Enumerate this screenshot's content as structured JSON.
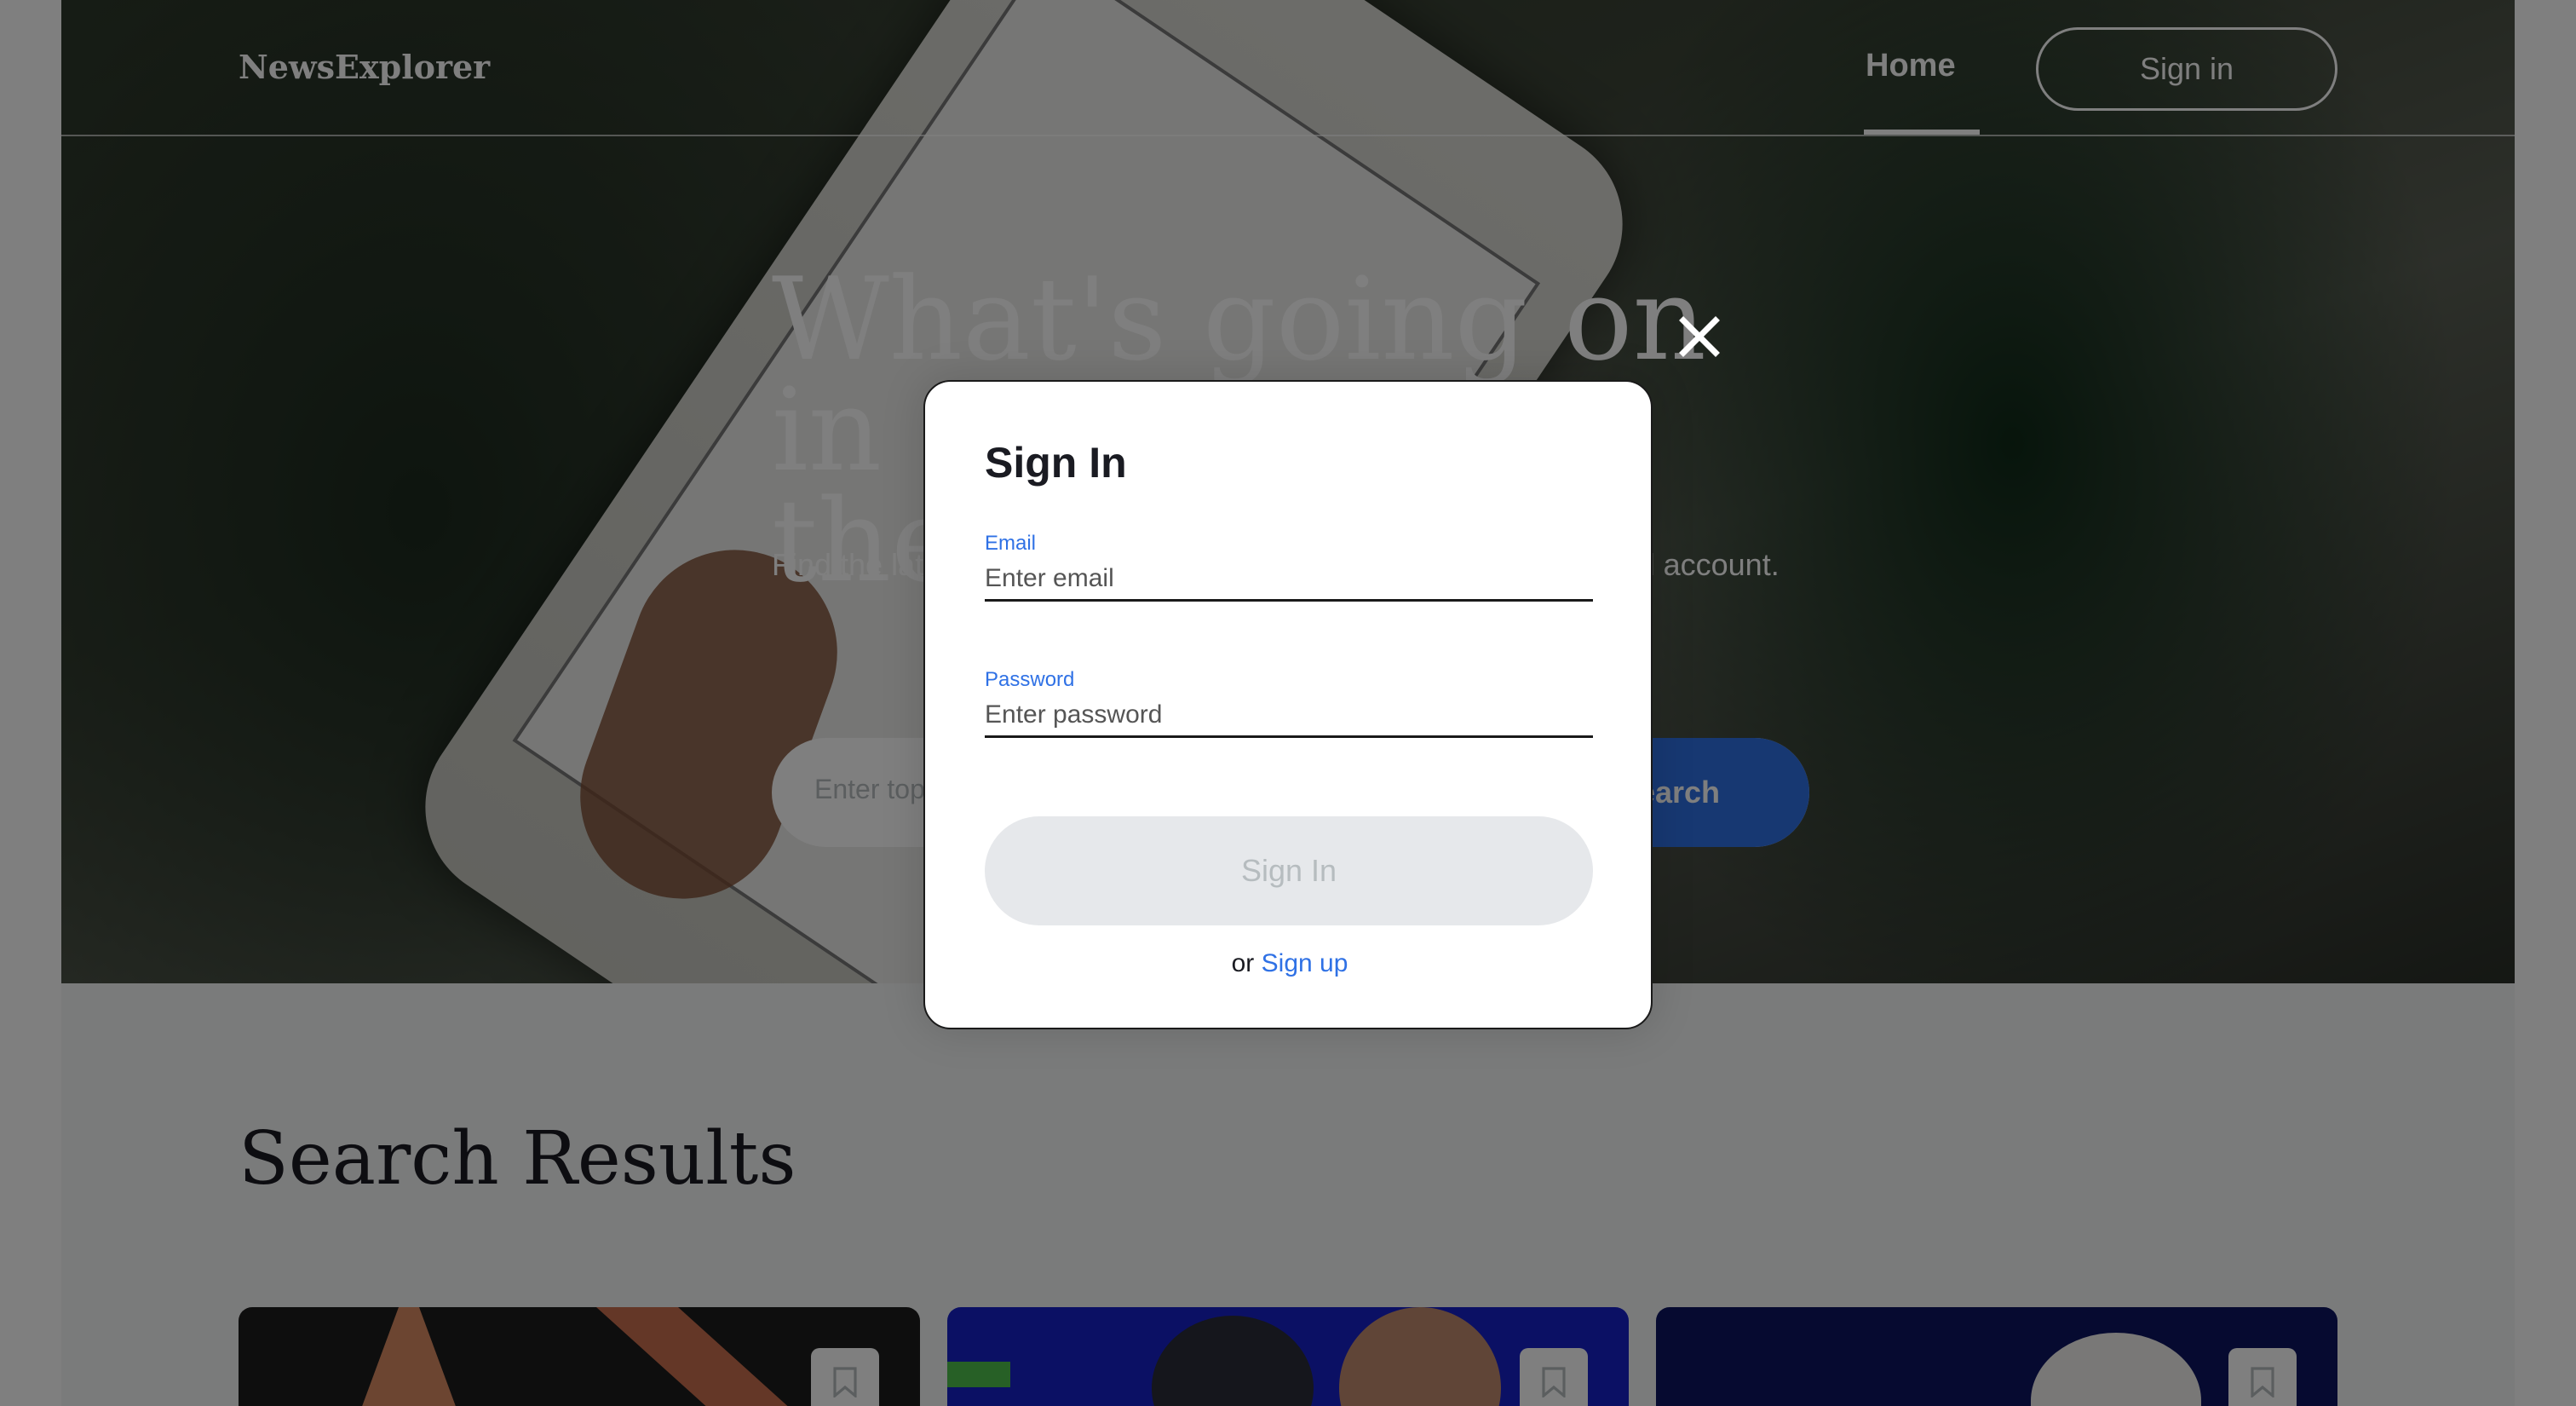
{
  "header": {
    "logo": "NewsExplorer",
    "nav_home": "Home",
    "nav_signin": "Sign in"
  },
  "hero": {
    "title_line1": "What's going on in",
    "title_line2": "the world?",
    "subtitle": "Find the latest news on any topic and save them in your personal account.",
    "search_placeholder": "Enter topic",
    "search_button": "Search"
  },
  "results": {
    "title": "Search Results",
    "cards": [
      {
        "bookmark_icon": "bookmark-icon"
      },
      {
        "bookmark_icon": "bookmark-icon"
      },
      {
        "bookmark_icon": "bookmark-icon"
      }
    ]
  },
  "modal": {
    "title": "Sign In",
    "email_label": "Email",
    "email_placeholder": "Enter email",
    "email_value": "",
    "password_label": "Password",
    "password_placeholder": "Enter password",
    "password_value": "",
    "submit_label": "Sign In",
    "alt_prefix": "or",
    "alt_link": "Sign up",
    "close_icon": "close-icon"
  },
  "colors": {
    "accent": "#2f71e5",
    "overlay": "rgba(0,0,0,0.5)",
    "button_disabled_bg": "#e6e8eb",
    "button_disabled_text": "#b6bcbf"
  }
}
